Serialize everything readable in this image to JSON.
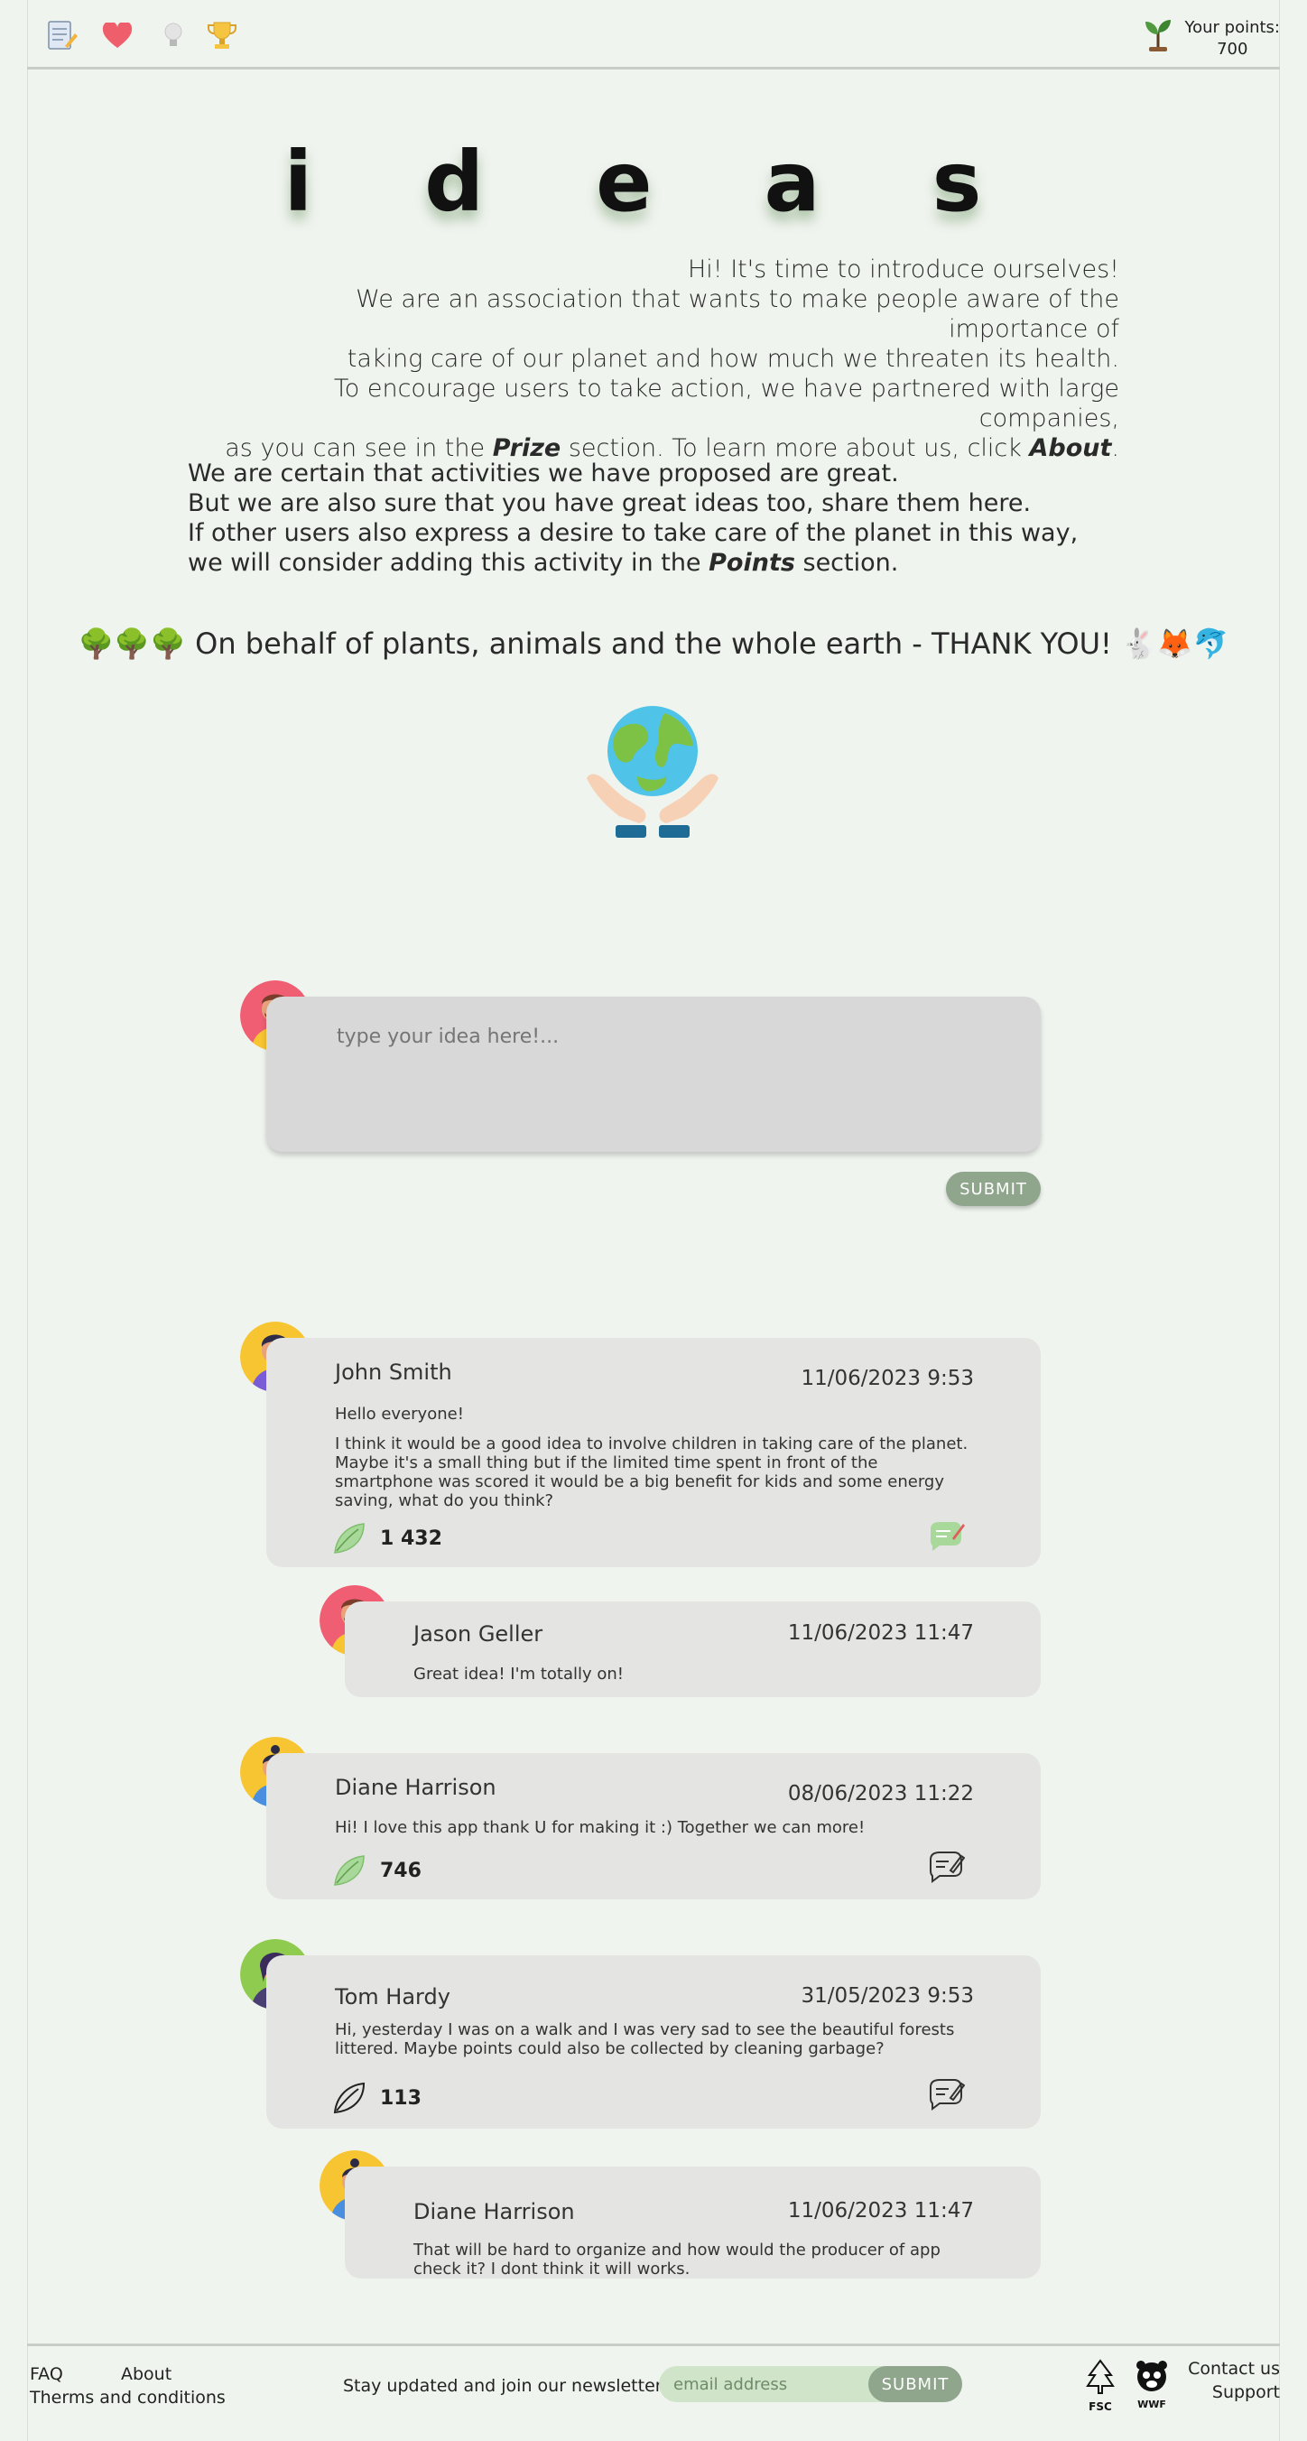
{
  "header": {
    "nav_icons": [
      "notes-icon",
      "heart-icon",
      "lightbulb-icon",
      "trophy-icon"
    ],
    "points_label": "Your points:",
    "points_value": "700"
  },
  "hero": {
    "title": "i d e a s",
    "intro_lines": [
      "Hi! It's time to introduce ourselves!",
      "We are an association that wants to make people aware of the importance of",
      "taking care of our planet and how much we threaten its health.",
      "To encourage users to take action, we have partnered with large companies,"
    ],
    "intro_last_a": "as you can see in the ",
    "intro_prize": "Prize",
    "intro_last_b": " section. To learn more about us, click ",
    "intro_about": "About",
    "intro_last_c": ".",
    "para_lines": [
      "We are certain that activities we have proposed are great.",
      "But we are also sure that you have great ideas too, share them here.",
      "If other users also express a desire to take care of the planet in this way,"
    ],
    "para_last_a": "we will consider adding this activity in the ",
    "para_points": "Points",
    "para_last_b": " section.",
    "thanks_left_emoji": "🌳🌳🌳",
    "thanks": "On behalf of plants, animals and the whole earth - THANK YOU!",
    "thanks_right_emoji": "🐇🦊🐬"
  },
  "compose": {
    "placeholder": "type your idea here!...",
    "submit": "SUBMIT"
  },
  "posts": [
    {
      "name": "John Smith",
      "date": "11/06/2023 9:53",
      "body_lines": [
        "Hello everyone!",
        "I think it would be a good idea to involve children in taking care of the planet. Maybe it's a small thing but if the limited time spent in front of the smartphone was scored it would be a big benefit for kids and some energy saving, what do you think?"
      ],
      "likes": "1 432",
      "liked": true
    },
    {
      "name": "Jason Geller",
      "date": "11/06/2023 11:47",
      "body": "Great idea! I'm totally on!"
    },
    {
      "name": "Diane Harrison",
      "date": "08/06/2023 11:22",
      "body": "Hi! I love this app thank U for making it :) Together we can more!",
      "likes": "746",
      "liked": true
    },
    {
      "name": "Tom Hardy",
      "date": "31/05/2023 9:53",
      "body": "Hi, yesterday I was on a walk and I was very sad to see the beautiful forests littered. Maybe points could also be collected by cleaning garbage?",
      "likes": "113",
      "liked": false
    },
    {
      "name": "Diane Harrison",
      "date": "11/06/2023 11:47",
      "body": "That will be hard to organize and how would the producer of app check it? I dont think it will works."
    }
  ],
  "footer": {
    "faq": "FAQ",
    "about": "About",
    "terms": "Therms and conditions",
    "newsletter_label": "Stay updated and join our newsletter:",
    "email_placeholder": "email address",
    "submit": "SUBMIT",
    "fsc": "FSC",
    "wwf": "WWF",
    "contact": "Contact us",
    "support": "Support"
  },
  "colors": {
    "background": "#f0f4ef",
    "accent_green": "#8fa58c",
    "card": "#e4e5e2",
    "compose": "#d8d8d8"
  }
}
